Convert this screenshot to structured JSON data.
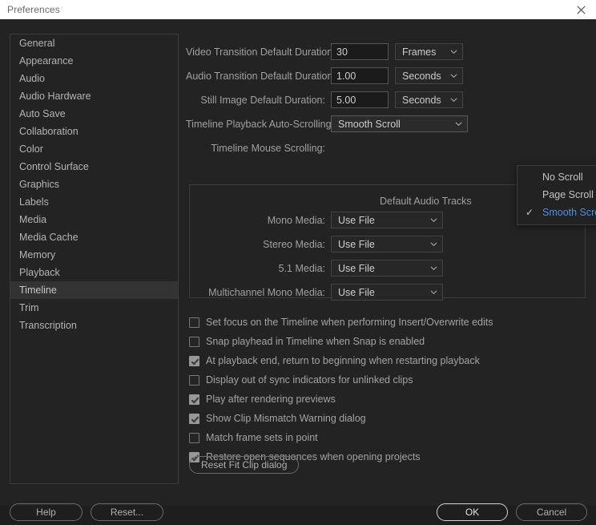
{
  "window": {
    "title": "Preferences",
    "close_icon": "close-icon"
  },
  "sidebar": {
    "items": [
      {
        "label": "General",
        "selected": false
      },
      {
        "label": "Appearance",
        "selected": false
      },
      {
        "label": "Audio",
        "selected": false
      },
      {
        "label": "Audio Hardware",
        "selected": false
      },
      {
        "label": "Auto Save",
        "selected": false
      },
      {
        "label": "Collaboration",
        "selected": false
      },
      {
        "label": "Color",
        "selected": false
      },
      {
        "label": "Control Surface",
        "selected": false
      },
      {
        "label": "Graphics",
        "selected": false
      },
      {
        "label": "Labels",
        "selected": false
      },
      {
        "label": "Media",
        "selected": false
      },
      {
        "label": "Media Cache",
        "selected": false
      },
      {
        "label": "Memory",
        "selected": false
      },
      {
        "label": "Playback",
        "selected": false
      },
      {
        "label": "Timeline",
        "selected": true
      },
      {
        "label": "Trim",
        "selected": false
      },
      {
        "label": "Transcription",
        "selected": false
      }
    ]
  },
  "main": {
    "fields": [
      {
        "label": "Video Transition Default Duration:",
        "value": "30",
        "unit": "Frames"
      },
      {
        "label": "Audio Transition Default Duration:",
        "value": "1.00",
        "unit": "Seconds"
      },
      {
        "label": "Still Image Default Duration:",
        "value": "5.00",
        "unit": "Seconds"
      }
    ],
    "auto_scroll": {
      "label": "Timeline Playback Auto-Scrolling:",
      "value": "Smooth Scroll",
      "options": [
        {
          "label": "No Scroll",
          "checked": false
        },
        {
          "label": "Page Scroll",
          "checked": false
        },
        {
          "label": "Smooth Scroll",
          "checked": true
        }
      ]
    },
    "mouse_scroll": {
      "label": "Timeline Mouse Scrolling:"
    },
    "audio_tracks": {
      "title": "Default Audio Tracks",
      "rows": [
        {
          "label": "Mono Media:",
          "value": "Use File"
        },
        {
          "label": "Stereo Media:",
          "value": "Use File"
        },
        {
          "label": "5.1 Media:",
          "value": "Use File"
        },
        {
          "label": "Multichannel Mono Media:",
          "value": "Use File"
        }
      ]
    },
    "checkboxes": [
      {
        "label": "Set focus on the Timeline when performing Insert/Overwrite edits",
        "checked": false
      },
      {
        "label": "Snap playhead in Timeline when Snap is enabled",
        "checked": false
      },
      {
        "label": "At playback end, return to beginning when restarting playback",
        "checked": true
      },
      {
        "label": "Display out of sync indicators for unlinked clips",
        "checked": false
      },
      {
        "label": "Play after rendering previews",
        "checked": true
      },
      {
        "label": "Show Clip Mismatch Warning dialog",
        "checked": true
      },
      {
        "label": "Match frame sets in point",
        "checked": false
      },
      {
        "label": "Restore open sequences when opening projects",
        "checked": true
      }
    ],
    "reset_fit_clip_label": "Reset Fit Clip dialog"
  },
  "footer": {
    "help_label": "Help",
    "reset_label": "Reset...",
    "ok_label": "OK",
    "cancel_label": "Cancel"
  },
  "colors": {
    "accent_blue": "#4a91e8",
    "dialog_bg": "#232323",
    "titlebar_bg": "#ffffff"
  }
}
